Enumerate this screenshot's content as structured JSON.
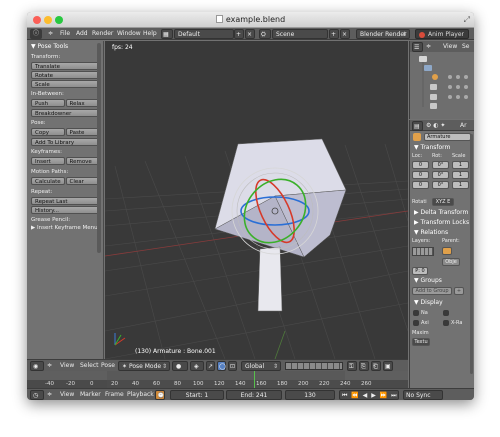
{
  "window": {
    "title": "example.blend"
  },
  "topbar": {
    "menus": [
      "File",
      "Add",
      "Render",
      "Window",
      "Help"
    ],
    "layout": "Default",
    "scene": "Scene",
    "engine": "Blender Render",
    "anim_player": "Anim Player"
  },
  "toolshelf": {
    "header": "Pose Tools",
    "transform_label": "Transform:",
    "translate": "Translate",
    "rotate": "Rotate",
    "scale": "Scale",
    "inbetween_label": "In-Between:",
    "push": "Push",
    "relax": "Relax",
    "breakdowner": "Breakdowner",
    "pose_label": "Pose:",
    "copy": "Copy",
    "paste": "Paste",
    "add_to_library": "Add To Library",
    "keyframes_label": "Keyframes:",
    "insert": "Insert",
    "remove": "Remove",
    "motion_paths_label": "Motion Paths:",
    "calculate": "Calculate",
    "clear": "Clear",
    "repeat_label": "Repeat:",
    "repeat_last": "Repeat Last",
    "history": "History...",
    "grease_pencil_label": "Grease Pencil:",
    "insert_keyframe_menu": "Insert Keyframe Menu"
  },
  "viewport": {
    "fps": "fps: 24",
    "status": "(130) Armature : Bone.001",
    "header": {
      "view": "View",
      "select": "Select",
      "pose": "Pose",
      "mode": "Pose Mode",
      "orientation": "Global"
    }
  },
  "timeline": {
    "ticks": [
      "-40",
      "-20",
      "0",
      "20",
      "40",
      "60",
      "80",
      "100",
      "120",
      "140",
      "160",
      "180",
      "200",
      "220",
      "240",
      "260"
    ],
    "header": {
      "view": "View",
      "marker": "Marker",
      "frame": "Frame",
      "playback": "Playback",
      "start": "Start: 1",
      "end": "End: 241",
      "current": "130",
      "sync": "No Sync"
    }
  },
  "outliner": {
    "view": "View",
    "search": "Se"
  },
  "properties": {
    "tab": "Ar",
    "name": "Armature",
    "transform": "Transform",
    "loc": "Loc:",
    "rot": "Rot:",
    "scale": "Scale",
    "loc_vals": [
      "0",
      "0",
      "0"
    ],
    "rot_vals": [
      "0°",
      "0°",
      "0°"
    ],
    "scale_vals": [
      "1",
      "1",
      "1"
    ],
    "rotation_label": "Rotati",
    "rotation_mode": "XYZ E",
    "delta_transform": "Delta Transform",
    "transform_locks": "Transform Locks",
    "relations": "Relations",
    "layers": "Layers:",
    "parent": "Parent:",
    "parent_type": "Obje",
    "pass_index": "P: 0",
    "groups": "Groups",
    "add_to_group": "Add to Group",
    "display": "Display",
    "na": "Na",
    "axi": "Axi",
    "xra": "X-Ra",
    "maxim": "Maxim",
    "textured": "Textu"
  }
}
